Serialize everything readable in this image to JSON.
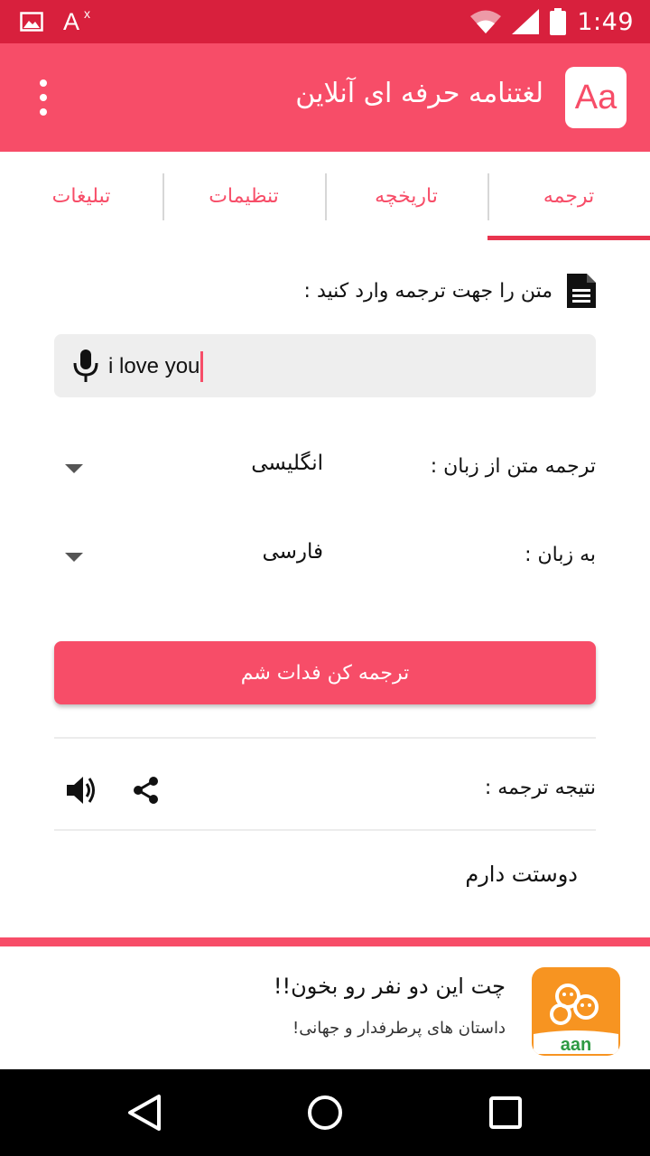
{
  "status_bar": {
    "time": "1:49",
    "a_label": "A",
    "a_sup": "x"
  },
  "app_bar": {
    "title": "لغتنامه حرفه ای آنلاین",
    "logo_text": "Aa"
  },
  "tabs": [
    {
      "label": "ترجمه",
      "active": true
    },
    {
      "label": "تاریخچه",
      "active": false
    },
    {
      "label": "تنظیمات",
      "active": false
    },
    {
      "label": "تبلیغات",
      "active": false
    }
  ],
  "main": {
    "prompt": "متن را جهت ترجمه وارد کنید :",
    "input_value": "i love you",
    "from_label": "ترجمه متن از زبان :",
    "from_value": "انگلیسی",
    "to_label": "به زبان :",
    "to_value": "فارسی",
    "translate_button": "ترجمه کن فدات شم",
    "result_label": "نتیجه ترجمه :",
    "result_text": "دوستت دارم"
  },
  "ad": {
    "title": "چت این دو نفر رو بخون!!",
    "subtitle": "داستان های پرطرفدار و جهانی!",
    "logo_text": "aan"
  },
  "colors": {
    "status": "#d8203d",
    "primary": "#f74d68",
    "ad_logo": "#f79421"
  }
}
